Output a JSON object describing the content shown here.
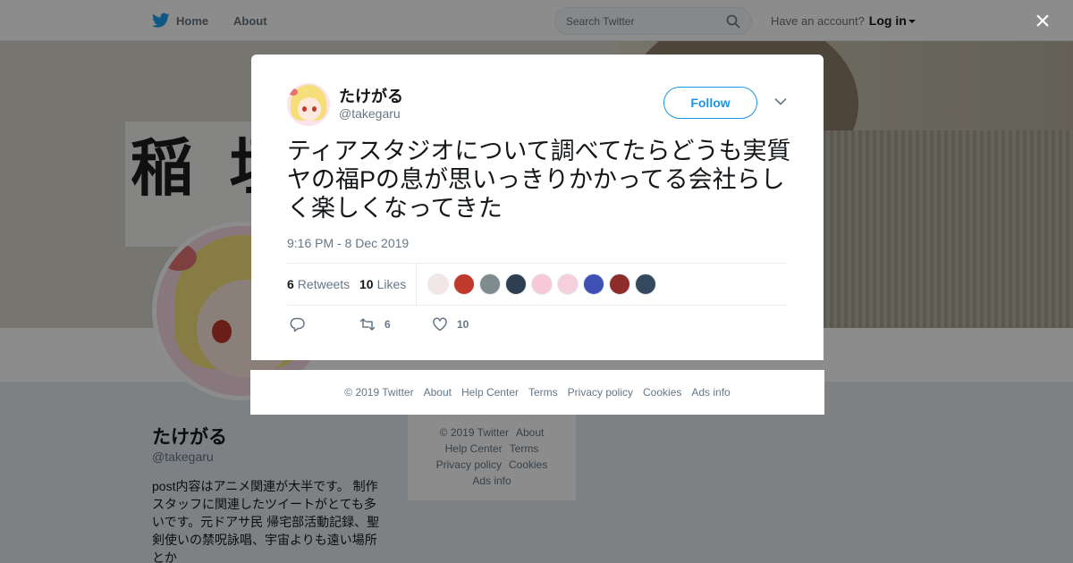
{
  "topbar": {
    "home_label": "Home",
    "about_label": "About",
    "search_placeholder": "Search Twitter",
    "account_prompt": "Have an account?",
    "login_label": "Log in"
  },
  "banner": {
    "poster_text": "稲 垣"
  },
  "profile": {
    "name": "たけがる",
    "handle": "@takegaru",
    "bio": "post内容はアニメ関連が大半です。 制作スタッフに関連したツイートがとても多いです。元ドアサ民 帰宅部活動記録、聖剣使いの禁呪詠唱、宇宙よりも遠い場所とか"
  },
  "side_footer": {
    "copyright": "© 2019 Twitter",
    "about": "About",
    "help": "Help Center",
    "terms": "Terms",
    "privacy": "Privacy policy",
    "cookies": "Cookies",
    "ads": "Ads info"
  },
  "close_label": "×",
  "tweet": {
    "author_name": "たけがる",
    "author_handle": "@takegaru",
    "follow_label": "Follow",
    "text": "ティアスタジオについて調べてたらどうも実質ヤの福Pの息が思いっきりかかってる会社らしく楽しくなってきた",
    "timestamp": "9:16 PM - 8 Dec 2019",
    "retweets_count": "6",
    "retweets_label": "Retweets",
    "likes_count": "10",
    "likes_label": "Likes",
    "liker_colors": [
      "#f2e6e6",
      "#c0392b",
      "#7f8c8d",
      "#2c3e50",
      "#f8c8d8",
      "#f5d0dc",
      "#3f51b5",
      "#8e2b2b",
      "#34495e"
    ],
    "reply_count": "",
    "retweet_action_count": "6",
    "like_action_count": "10"
  },
  "modal_footer": {
    "copyright": "© 2019 Twitter",
    "about": "About",
    "help": "Help Center",
    "terms": "Terms",
    "privacy": "Privacy policy",
    "cookies": "Cookies",
    "ads": "Ads info"
  },
  "colors": {
    "accent": "#1b95e0",
    "twitter_blue": "#1da1f2",
    "muted_text": "#657786"
  }
}
